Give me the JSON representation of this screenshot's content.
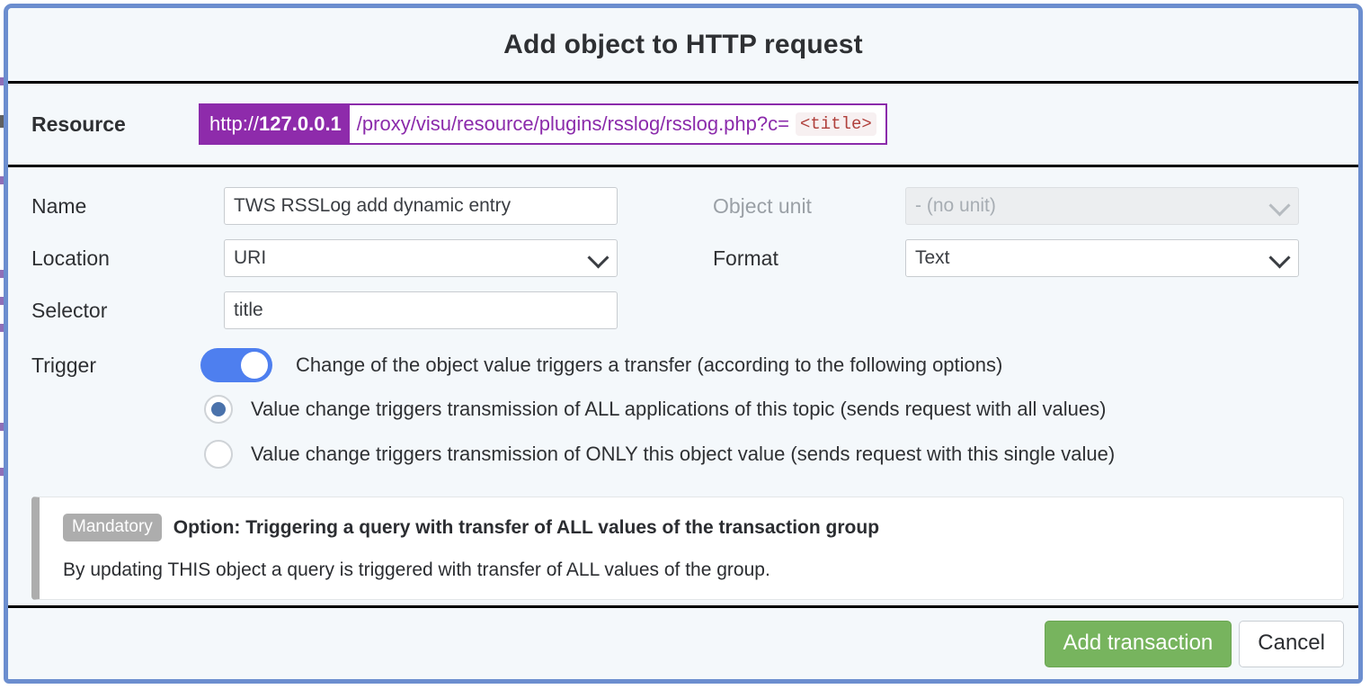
{
  "dialog": {
    "title": "Add object to HTTP request",
    "accent_border": "#6c8ecf",
    "background": "#f4f8fb"
  },
  "resource": {
    "label": "Resource",
    "host_scheme": "http://",
    "host": "127.0.0.1",
    "path": "/proxy/visu/resource/plugins/rsslog/rsslog.php?c=",
    "token": "<title>",
    "accent": "#8e2bab"
  },
  "form": {
    "name": {
      "label": "Name",
      "value": "TWS RSSLog add dynamic entry",
      "placeholder": ""
    },
    "location": {
      "label": "Location",
      "value": "URI"
    },
    "selector": {
      "label": "Selector",
      "value": "title",
      "placeholder": ""
    },
    "object_unit": {
      "label": "Object unit",
      "value": "- (no unit)",
      "disabled": true
    },
    "format": {
      "label": "Format",
      "value": "Text"
    }
  },
  "trigger": {
    "label": "Trigger",
    "toggle_on": true,
    "toggle_text": "Change of the object value triggers a transfer (according to the following options)",
    "options": [
      {
        "text": "Value change triggers transmission of ALL applications of this topic (sends request with all values)",
        "selected": true
      },
      {
        "text": "Value change triggers transmission of ONLY this object value (sends request with this single value)",
        "selected": false
      }
    ]
  },
  "info": {
    "badge": "Mandatory",
    "title": "Option: Triggering a query with transfer of ALL values of the transaction group",
    "body": "By updating THIS object a query is triggered with transfer of ALL values of the group.",
    "badge_color": "#adadad"
  },
  "footer": {
    "submit_label": "Add transaction",
    "cancel_label": "Cancel",
    "submit_color": "#77b45e"
  }
}
